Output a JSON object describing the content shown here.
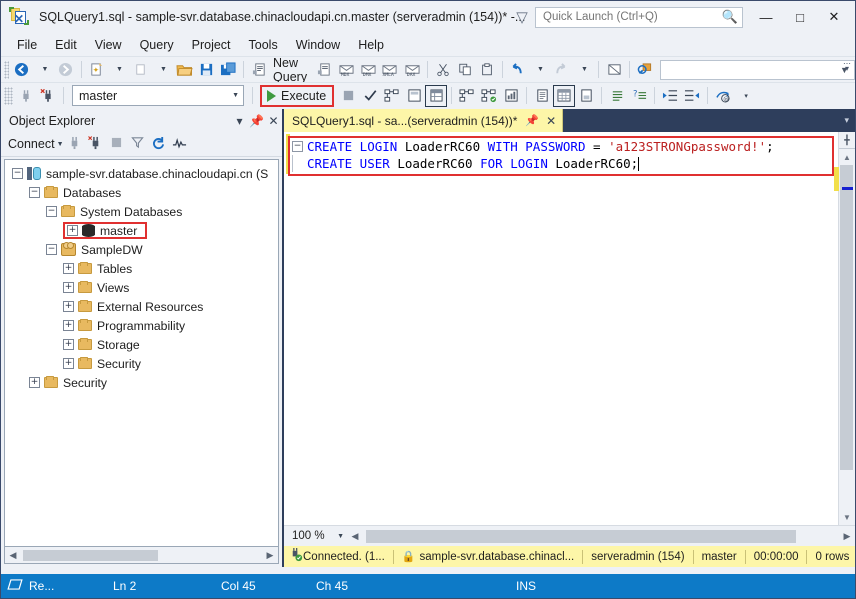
{
  "window": {
    "title": "SQLQuery1.sql - sample-svr.database.chinacloudapi.cn.master (serveradmin (154))* -...",
    "logo_name": "ssms-logo",
    "minimize": "—",
    "maximize": "□",
    "close": "✕"
  },
  "quick_launch": {
    "placeholder": "Quick Launch (Ctrl+Q)",
    "value": "",
    "search_icon": "search-icon",
    "funnel_icon": "funnel-icon"
  },
  "menu": {
    "items": [
      {
        "label": "File"
      },
      {
        "label": "Edit"
      },
      {
        "label": "View"
      },
      {
        "label": "Query"
      },
      {
        "label": "Project"
      },
      {
        "label": "Tools"
      },
      {
        "label": "Window"
      },
      {
        "label": "Help"
      }
    ]
  },
  "toolbar_top": {
    "nav_back": "◄",
    "nav_forward": "►",
    "new_project": "new-project-icon",
    "add_item": "add-item-icon",
    "open_file": "open-folder-icon",
    "save": "save-icon",
    "save_all": "save-all-icon",
    "new_query_label": "New Query",
    "query_types": [
      "MDX",
      "DMX",
      "XMLA",
      "DAX"
    ],
    "cut": "✂",
    "copy": "copy-icon",
    "paste": "paste-icon",
    "undo": "↰",
    "redo": "↱",
    "find": "find-icon",
    "search_combo_value": ""
  },
  "toolbar_query": {
    "connect": "connect-icon",
    "disconnect": "disconnect-icon",
    "database_value": "master",
    "execute_label": "Execute",
    "execute_highlighted": true,
    "stop": "stop-icon",
    "parse": "✓",
    "display_estimated_plan": "estimated-plan-icon",
    "include_actual_plan": "actual-plan-icon",
    "include_client_statistics": "client-stats-icon",
    "results_to_text": "results-to-text-icon",
    "results_to_grid": "results-to-grid-icon",
    "results_to_file": "results-to-file-icon",
    "comment": "comment-icon",
    "uncomment": "uncomment-icon",
    "decrease_indent": "decrease-indent-icon",
    "increase_indent": "increase-indent-icon",
    "specify_values": "specify-values-icon"
  },
  "object_explorer": {
    "title": "Object Explorer",
    "dropdown_icon": "▾",
    "pin_icon": "pin-icon",
    "close_icon": "✕",
    "connect_label": "Connect",
    "toolbar_icons": [
      "connect-plug-icon",
      "disconnect-plug-icon",
      "stop-icon",
      "filter-funnel-icon",
      "refresh-icon",
      "activity-monitor-icon"
    ],
    "tree": [
      {
        "label": "sample-svr.database.chinacloudapi.cn (S",
        "indent": 0,
        "expander": "−",
        "icon": "server-icon",
        "highlight": false
      },
      {
        "label": "Databases",
        "indent": 1,
        "expander": "−",
        "icon": "folder-icon",
        "highlight": false
      },
      {
        "label": "System Databases",
        "indent": 2,
        "expander": "−",
        "icon": "folder-icon",
        "highlight": false
      },
      {
        "label": "master",
        "indent": 3,
        "expander": "+",
        "icon": "database-icon",
        "highlight": true
      },
      {
        "label": "SampleDW",
        "indent": 2,
        "expander": "−",
        "icon": "datawarehouse-icon",
        "highlight": false
      },
      {
        "label": "Tables",
        "indent": 3,
        "expander": "+",
        "icon": "folder-icon",
        "highlight": false
      },
      {
        "label": "Views",
        "indent": 3,
        "expander": "+",
        "icon": "folder-icon",
        "highlight": false
      },
      {
        "label": "External Resources",
        "indent": 3,
        "expander": "+",
        "icon": "folder-icon",
        "highlight": false
      },
      {
        "label": "Programmability",
        "indent": 3,
        "expander": "+",
        "icon": "folder-icon",
        "highlight": false
      },
      {
        "label": "Storage",
        "indent": 3,
        "expander": "+",
        "icon": "folder-icon",
        "highlight": false
      },
      {
        "label": "Security",
        "indent": 3,
        "expander": "+",
        "icon": "folder-icon",
        "highlight": false
      },
      {
        "label": "Security",
        "indent": 1,
        "expander": "+",
        "icon": "folder-icon",
        "highlight": false
      }
    ]
  },
  "editor": {
    "tab_label": "SQLQuery1.sql - sa...(serveradmin (154))*",
    "tab_pin": "pin-icon",
    "tab_close": "✕",
    "tabstrip_dropdown": "▾",
    "code_highlighted": true,
    "lines": [
      {
        "collapse": "−",
        "tokens": [
          {
            "text": "CREATE LOGIN ",
            "kind": "keyword"
          },
          {
            "text": "LoaderRC60 ",
            "kind": "plain"
          },
          {
            "text": "WITH PASSWORD ",
            "kind": "keyword"
          },
          {
            "text": "= ",
            "kind": "plain"
          },
          {
            "text": "'a123STRONGpassword!'",
            "kind": "string"
          },
          {
            "text": ";",
            "kind": "plain"
          }
        ]
      },
      {
        "collapse": "",
        "tokens": [
          {
            "text": "CREATE USER ",
            "kind": "keyword"
          },
          {
            "text": "LoaderRC60 ",
            "kind": "plain"
          },
          {
            "text": "FOR LOGIN ",
            "kind": "keyword"
          },
          {
            "text": "LoaderRC60",
            "kind": "plain"
          },
          {
            "text": ";",
            "kind": "plain"
          }
        ]
      }
    ],
    "zoom_level": "100 %",
    "zoom_caret": "▾"
  },
  "editor_status": {
    "connection_icon": "connected-plug-icon",
    "connected": "Connected. (1...",
    "lock_icon": "lock-icon",
    "server": "sample-svr.database.chinacl...",
    "login": "serveradmin (154)",
    "database": "master",
    "elapsed": "00:00:00",
    "rows": "0 rows"
  },
  "app_status": {
    "icon": "ready-icon",
    "ready": "Re...",
    "line": "Ln 2",
    "column": "Col 45",
    "character": "Ch 45",
    "insert_mode": "INS"
  },
  "colors": {
    "accent_blue": "#0d7ac7",
    "highlight_red": "#e03030",
    "tab_yellow": "#fdf6a8",
    "keyword_blue": "#0000ff",
    "string_red": "#bb2020",
    "chrome": "#eef1f6",
    "dock_navy": "#2e3e5c",
    "execute_green": "#3f9a3f"
  }
}
